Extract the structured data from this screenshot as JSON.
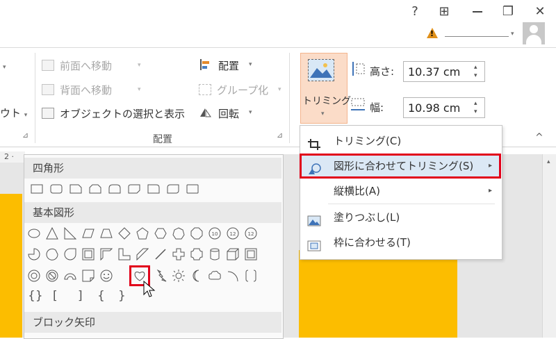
{
  "titlebar": {
    "help": "?",
    "ribbon_display": "⊞",
    "restore": "❐",
    "close": "✕",
    "warning_mark": "!",
    "account_caret": "▾"
  },
  "ribbon": {
    "left_cut_label": "ウト",
    "left_cut_caret": "▾",
    "arrange": {
      "bring_forward": "前面へ移動",
      "send_backward": "背面へ移動",
      "selection_pane": "オブジェクトの選択と表示",
      "align": "配置",
      "group": "グループ化",
      "rotate": "回転",
      "caret": "▾",
      "group_label": "配置"
    },
    "size": {
      "crop_label": "トリミング",
      "crop_caret": "▾",
      "height_label": "高さ:",
      "height_value": "10.37 cm",
      "width_label": "幅:",
      "width_value": "10.98 cm",
      "spin_up": "▴",
      "spin_down": "▾"
    },
    "collapse": "^",
    "launcher": "⊿"
  },
  "ruler": {
    "text": "2 ·"
  },
  "gallery": {
    "rectangles_header": "四角形",
    "basic_shapes_header": "基本図形",
    "block_arrows_header": "ブロック矢印",
    "brace_row": [
      "{}",
      "[",
      "]",
      "{",
      "}"
    ]
  },
  "crop_menu": {
    "items": [
      {
        "label": "トリミング(C)",
        "has_arrow": false
      },
      {
        "label": "図形に合わせてトリミング(S)",
        "has_arrow": true
      },
      {
        "label": "縦横比(A)",
        "has_arrow": true
      },
      {
        "label": "塗りつぶし(L)",
        "has_arrow": false
      },
      {
        "label": "枠に合わせる(T)",
        "has_arrow": false
      }
    ],
    "arrow": "▸"
  },
  "colors": {
    "accent_red": "#e1001a",
    "slide_yellow": "#fcbd00",
    "crop_button_bg": "#fbdcc8",
    "menu_highlight": "#dbe8f5"
  }
}
